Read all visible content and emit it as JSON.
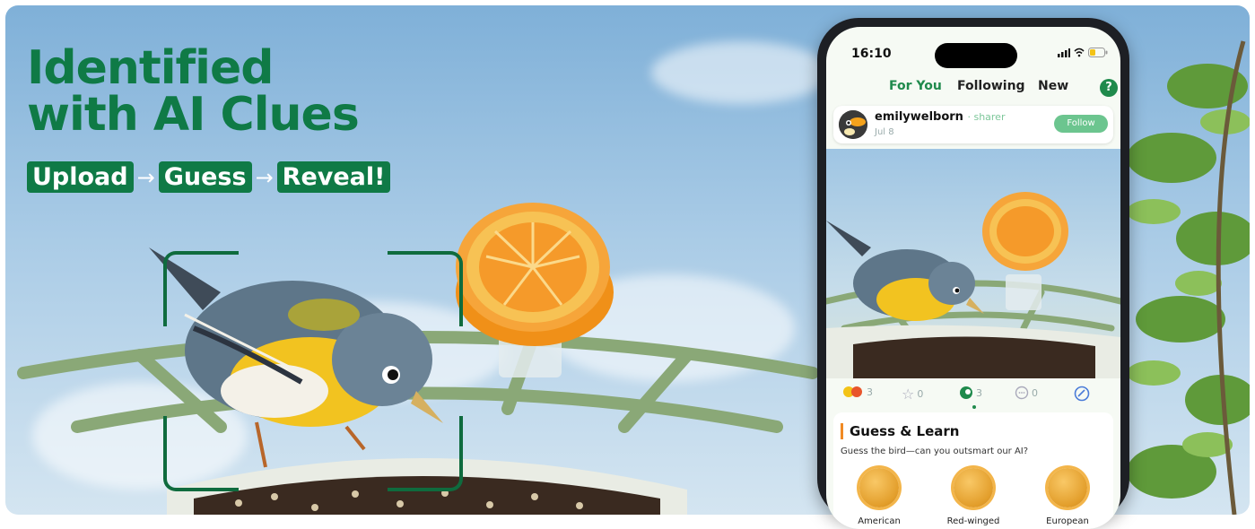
{
  "headline": {
    "line1": "Identified",
    "line2": "with AI Clues"
  },
  "steps": {
    "s1": "Upload",
    "s2": "Guess",
    "s3": "Reveal!",
    "arrow": "→"
  },
  "phone": {
    "time": "16:10",
    "tabs": {
      "for_you": "For You",
      "following": "Following",
      "new": "New",
      "help": "?"
    },
    "post": {
      "username": "emilywelborn",
      "role": "· sharer",
      "date": "Jul 8",
      "follow_label": "Follow"
    },
    "actions": {
      "reactions": "3",
      "favorites": "0",
      "guesses": "3",
      "comments": "0"
    },
    "card": {
      "title": "Guess & Learn",
      "subtitle": "Guess the bird—can you outsmart our AI?",
      "options": [
        "American",
        "Red-winged",
        "European"
      ]
    }
  },
  "colors": {
    "brand_green": "#0f7a46",
    "accent_orange": "#f08a24",
    "follow_green": "#6cc58f"
  }
}
